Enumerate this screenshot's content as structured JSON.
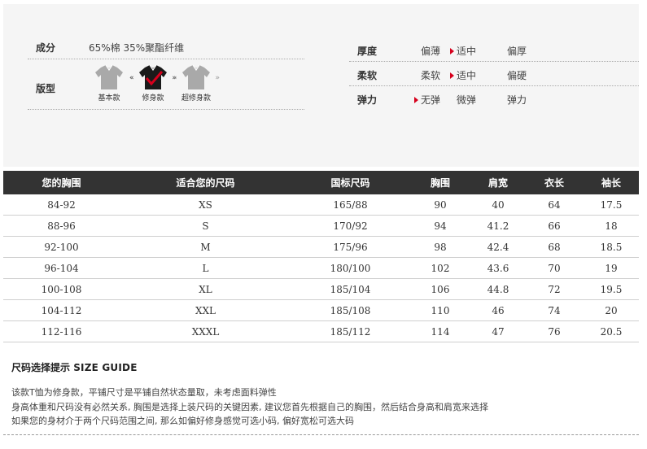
{
  "material": {
    "label": "成分",
    "value": "65%棉 35%聚酯纤维"
  },
  "fit": {
    "label": "版型",
    "options": [
      {
        "caption": "基本款",
        "selected": false
      },
      {
        "caption": "修身款",
        "selected": true
      },
      {
        "caption": "超修身款",
        "selected": false
      }
    ]
  },
  "attributes": [
    {
      "label": "厚度",
      "options": [
        "偏薄",
        "适中",
        "偏厚"
      ],
      "selected": 1
    },
    {
      "label": "柔软",
      "options": [
        "柔软",
        "适中",
        "偏硬"
      ],
      "selected": 1
    },
    {
      "label": "弹力",
      "options": [
        "无弹",
        "微弹",
        "弹力"
      ],
      "selected": 0
    }
  ],
  "size_table": {
    "headers": [
      "您的胸围",
      "适合您的尺码",
      "国标尺码",
      "胸围",
      "肩宽",
      "衣长",
      "袖长"
    ],
    "rows": [
      [
        "84-92",
        "XS",
        "165/88",
        "90",
        "40",
        "64",
        "17.5"
      ],
      [
        "88-96",
        "S",
        "170/92",
        "94",
        "41.2",
        "66",
        "18"
      ],
      [
        "92-100",
        "M",
        "175/96",
        "98",
        "42.4",
        "68",
        "18.5"
      ],
      [
        "96-104",
        "L",
        "180/100",
        "102",
        "43.6",
        "70",
        "19"
      ],
      [
        "100-108",
        "XL",
        "185/104",
        "106",
        "44.8",
        "72",
        "19.5"
      ],
      [
        "104-112",
        "XXL",
        "185/108",
        "110",
        "46",
        "74",
        "20"
      ],
      [
        "112-116",
        "XXXL",
        "185/112",
        "114",
        "47",
        "76",
        "20.5"
      ]
    ]
  },
  "guide": {
    "title_cn": "尺码选择提示",
    "title_en": "SIZE GUIDE",
    "lines": [
      "该款T恤为修身款，平铺尺寸是平铺自然状态量取，未考虑面料弹性",
      "身高体重和尺码没有必然关系, 胸围是选择上装尺码的关键因素, 建议您首先根据自己的胸围，然后结合身高和肩宽来选择",
      "如果您的身材介于两个尺码范围之间, 那么如偏好修身感觉可选小码, 偏好宽松可选大码"
    ]
  },
  "colors": {
    "accent": "#d6001c",
    "header_bg": "#333333",
    "panel_bg": "#f5f5f5"
  }
}
